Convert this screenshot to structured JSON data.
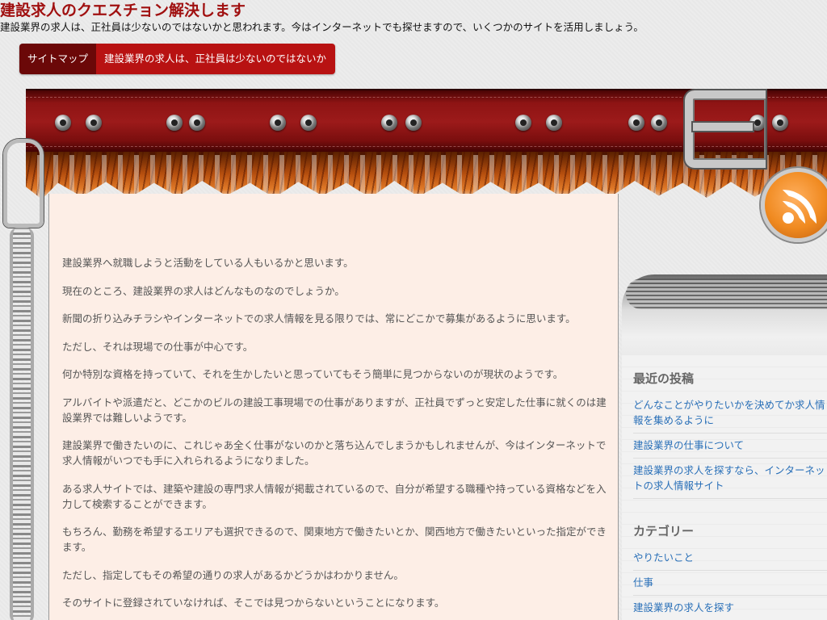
{
  "site": {
    "title": "建設求人のクエスチョン解決します",
    "description": "建設業界の求人は、正社員は少ないのではないかと思われます。今はインターネットでも探せますので、いくつかのサイトを活用しましょう。"
  },
  "nav": {
    "items": [
      {
        "label": "サイトマップ"
      },
      {
        "label": "建設業界の求人は、正社員は少ないのではないか"
      }
    ]
  },
  "article": {
    "paragraphs": [
      "建設業界へ就職しようと活動をしている人もいるかと思います。",
      "現在のところ、建設業界の求人はどんなものなのでしょうか。",
      "新聞の折り込みチラシやインターネットでの求人情報を見る限りでは、常にどこかで募集があるように思います。",
      "ただし、それは現場での仕事が中心です。",
      "何か特別な資格を持っていて、それを生かしたいと思っていてもそう簡単に見つからないのが現状のようです。",
      "アルバイトや派遣だと、どこかのビルの建設工事現場での仕事がありますが、正社員でずっと安定した仕事に就くのは建設業界では難しいようです。",
      "建設業界で働きたいのに、これじゃあ全く仕事がないのかと落ち込んでしまうかもしれませんが、今はインターネットで求人情報がいつでも手に入れられるようになりました。",
      "ある求人サイトでは、建築や建設の専門求人情報が掲載されているので、自分が希望する職種や持っている資格などを入力して検索することができます。",
      "もちろん、勤務を希望するエリアも選択できるので、関東地方で働きたいとか、関西地方で働きたいといった指定ができます。",
      "ただし、指定してもその希望の通りの求人があるかどうかはわかりません。",
      "そのサイトに登録されていなければ、そこでは見つからないということになります。"
    ]
  },
  "sidebar": {
    "recent": {
      "title": "最近の投稿",
      "items": [
        "どんなことがやりたいかを決めてか求人情\n報を集めるように",
        "建設業界の仕事について",
        "建設業界の求人を探すなら、インターネッ\nトの求人情報サイト"
      ]
    },
    "categories": {
      "title": "カテゴリー",
      "items": [
        "やりたいこと",
        "仕事",
        "建設業界の求人を探す"
      ]
    }
  },
  "colors": {
    "title": "#a01010",
    "nav_dark": "#6b0808",
    "nav_red": "#b81212",
    "link": "#2a70b8",
    "content_bg": "#fdeee6"
  },
  "icons": [
    "rss-icon",
    "belt-buckle-icon",
    "chain-icon"
  ]
}
